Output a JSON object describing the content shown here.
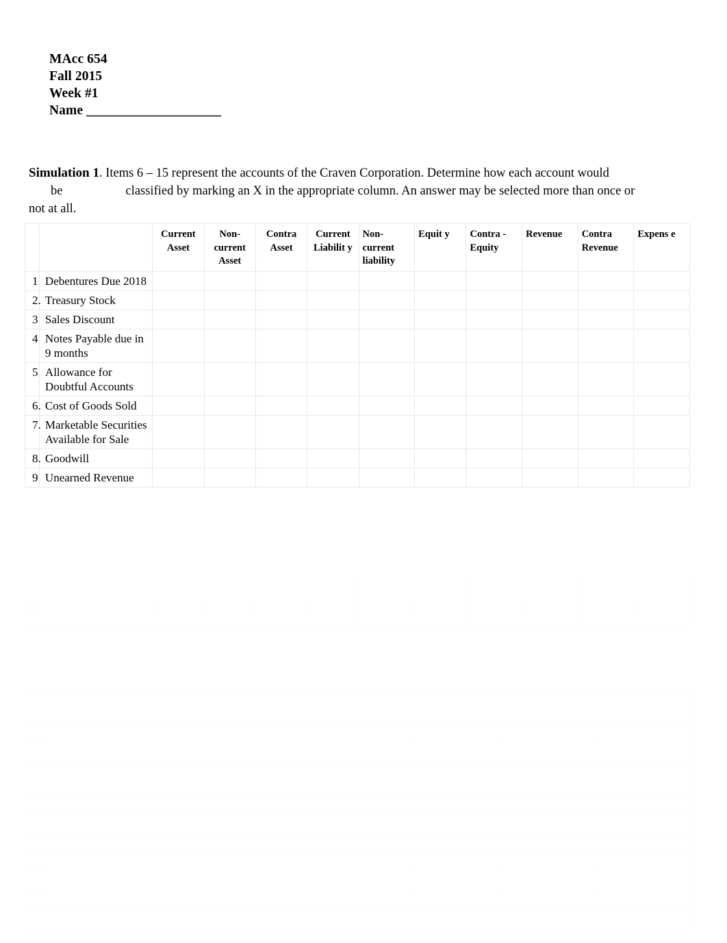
{
  "header": {
    "course": "MAcc 654",
    "term": "Fall 2015",
    "week": "Week #1",
    "name_line": "Name ____________________"
  },
  "simulation1": {
    "lead": "Simulation 1",
    "text_line1": ". Items 6 – 15 represent the accounts of the Craven Corporation. Determine how each account would",
    "text_line2_a": "be",
    "text_line2_b": "classified by marking an X in the appropriate column. An answer may be selected more than once or",
    "text_line3": "not at all.",
    "table": {
      "headers": [
        "",
        "",
        "Current Asset",
        "Non-current Asset",
        "Contra Asset",
        "Current Liabilit y",
        "Non-current liability",
        "Equit y",
        "Contra -Equity",
        "Revenue",
        "Contra Revenue",
        "Expens e"
      ],
      "rows": [
        {
          "num": "1",
          "account": "Debentures Due 2018"
        },
        {
          "num": "2.",
          "account": "Treasury Stock"
        },
        {
          "num": "3",
          "account": "Sales Discount"
        },
        {
          "num": "4",
          "account": "Notes Payable due in 9 months"
        },
        {
          "num": "5",
          "account": "Allowance for Doubtful Accounts"
        },
        {
          "num": "6.",
          "account": "Cost of Goods Sold"
        },
        {
          "num": "7.",
          "account": "Marketable Securities Available for Sale"
        },
        {
          "num": "8.",
          "account": "Goodwill"
        },
        {
          "num": "9",
          "account": "Unearned Revenue"
        }
      ],
      "faded_rows": [
        {
          "num": "",
          "account": ""
        },
        {
          "num": "",
          "account": ""
        }
      ]
    }
  },
  "simulation2": {
    "heading": "",
    "table": {
      "prompt": "",
      "headers": [
        "",
        "",
        "",
        "",
        ""
      ],
      "rows": [
        {
          "num": "",
          "desc": ""
        },
        {
          "num": "",
          "desc": ""
        },
        {
          "num": "",
          "desc": ""
        },
        {
          "num": "",
          "desc": ""
        },
        {
          "num": "",
          "desc": ""
        },
        {
          "num": "",
          "desc": ""
        },
        {
          "num": "",
          "desc": ""
        },
        {
          "num": "",
          "desc": ""
        },
        {
          "num": "",
          "desc": ""
        },
        {
          "num": "",
          "desc": ""
        }
      ]
    }
  }
}
